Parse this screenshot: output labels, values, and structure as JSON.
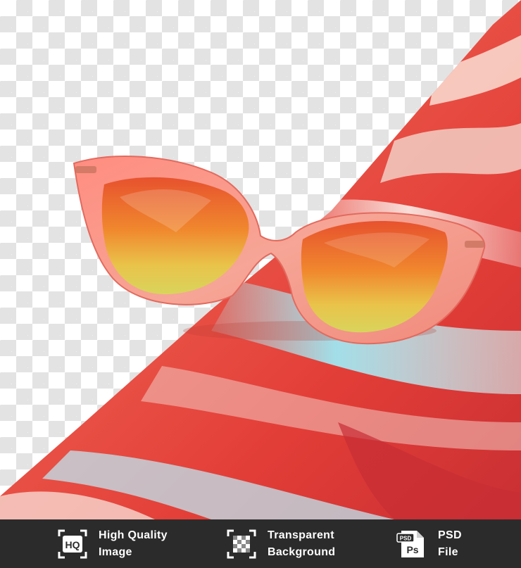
{
  "image": {
    "subject": "pink cat-eye sunglasses with orange-yellow lenses on draped satin fabric",
    "background": "transparency checkerboard",
    "fabric_colors": [
      "#e8443c",
      "#f07a70",
      "#a9e6ef",
      "#f3d9d2"
    ],
    "frame_color": "#f59a8e",
    "lens_color": "#f0a23a"
  },
  "footer": {
    "features": [
      {
        "icon": "hq-icon",
        "line1": "High Quality",
        "line2": "Image"
      },
      {
        "icon": "transparent-background-icon",
        "line1": "Transparent",
        "line2": "Background"
      },
      {
        "icon": "psd-file-icon",
        "line1": "PSD",
        "line2": "File"
      }
    ],
    "icon_text": {
      "hq": "HQ",
      "psd": "PSD",
      "ps": "Ps"
    }
  }
}
